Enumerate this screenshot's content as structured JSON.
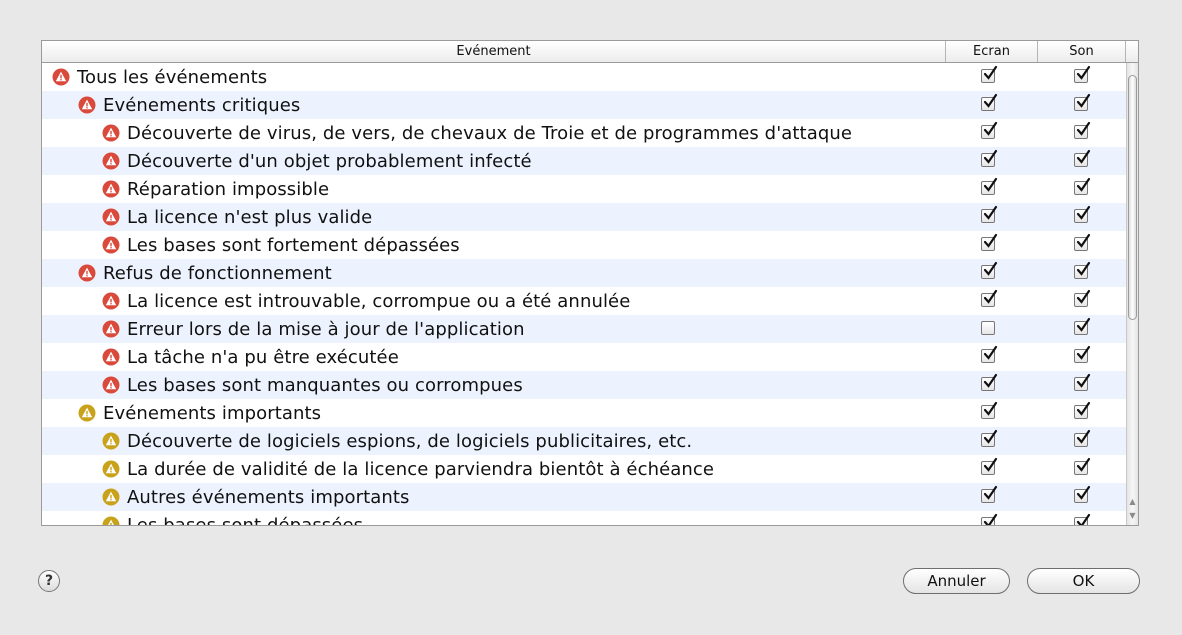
{
  "table": {
    "columns": {
      "event": "Evénement",
      "screen": "Ecran",
      "sound": "Son"
    },
    "rows": [
      {
        "label": "Tous les événements",
        "level": 0,
        "severity": "critical",
        "screen": true,
        "sound": true
      },
      {
        "label": "Evénements critiques",
        "level": 1,
        "severity": "critical",
        "screen": true,
        "sound": true
      },
      {
        "label": "Découverte de virus, de vers, de chevaux de Troie et de programmes d'attaque",
        "level": 2,
        "severity": "critical",
        "screen": true,
        "sound": true
      },
      {
        "label": "Découverte d'un objet probablement infecté",
        "level": 2,
        "severity": "critical",
        "screen": true,
        "sound": true
      },
      {
        "label": "Réparation impossible",
        "level": 2,
        "severity": "critical",
        "screen": true,
        "sound": true
      },
      {
        "label": "La licence n'est plus valide",
        "level": 2,
        "severity": "critical",
        "screen": true,
        "sound": true
      },
      {
        "label": "Les bases sont fortement dépassées",
        "level": 2,
        "severity": "critical",
        "screen": true,
        "sound": true
      },
      {
        "label": "Refus de fonctionnement",
        "level": 1,
        "severity": "critical",
        "screen": true,
        "sound": true
      },
      {
        "label": "La licence est introuvable, corrompue ou a été annulée",
        "level": 2,
        "severity": "critical",
        "screen": true,
        "sound": true
      },
      {
        "label": "Erreur lors de la mise à jour de l'application",
        "level": 2,
        "severity": "critical",
        "screen": false,
        "sound": true
      },
      {
        "label": "La tâche n'a pu être exécutée",
        "level": 2,
        "severity": "critical",
        "screen": true,
        "sound": true
      },
      {
        "label": "Les bases sont manquantes ou corrompues",
        "level": 2,
        "severity": "critical",
        "screen": true,
        "sound": true
      },
      {
        "label": "Evénements importants",
        "level": 1,
        "severity": "important",
        "screen": true,
        "sound": true
      },
      {
        "label": "Découverte de logiciels espions, de logiciels publicitaires, etc.",
        "level": 2,
        "severity": "important",
        "screen": true,
        "sound": true
      },
      {
        "label": "La durée de validité de la licence parviendra bientôt à échéance",
        "level": 2,
        "severity": "important",
        "screen": true,
        "sound": true
      },
      {
        "label": "Autres événements importants",
        "level": 2,
        "severity": "important",
        "screen": true,
        "sound": true
      },
      {
        "label": "Les bases sont dépassées",
        "level": 2,
        "severity": "important",
        "screen": true,
        "sound": true
      }
    ]
  },
  "icons": {
    "critical": {
      "name": "critical-warning-icon",
      "color": "#d94a3d"
    },
    "important": {
      "name": "important-warning-icon",
      "color": "#c9a21c"
    }
  },
  "buttons": {
    "help": "?",
    "cancel": "Annuler",
    "ok": "OK"
  }
}
